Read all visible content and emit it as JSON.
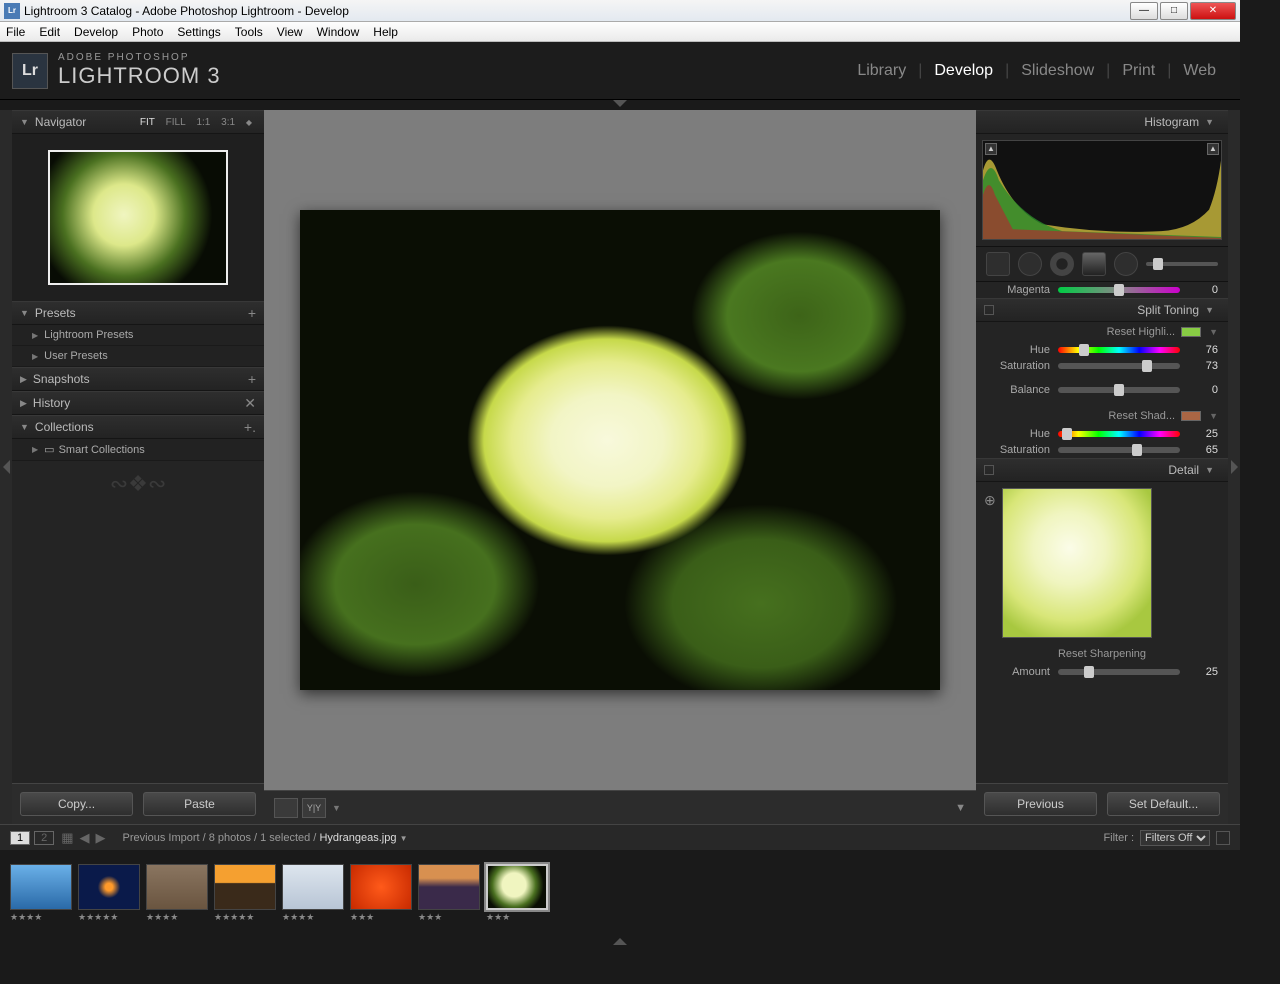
{
  "window": {
    "title": "Lightroom 3 Catalog - Adobe Photoshop Lightroom - Develop"
  },
  "menu": [
    "File",
    "Edit",
    "Develop",
    "Photo",
    "Settings",
    "Tools",
    "View",
    "Window",
    "Help"
  ],
  "brand": {
    "logo": "Lr",
    "sup": "ADOBE PHOTOSHOP",
    "main": "LIGHTROOM 3"
  },
  "modules": [
    "Library",
    "Develop",
    "Slideshow",
    "Print",
    "Web"
  ],
  "active_module": "Develop",
  "navigator": {
    "title": "Navigator",
    "zoom": [
      "FIT",
      "FILL",
      "1:1",
      "3:1"
    ],
    "zoom_active": "FIT"
  },
  "presets": {
    "title": "Presets",
    "items": [
      "Lightroom Presets",
      "User Presets"
    ]
  },
  "snapshots": {
    "title": "Snapshots"
  },
  "history": {
    "title": "History"
  },
  "collections": {
    "title": "Collections",
    "items": [
      "Smart Collections"
    ]
  },
  "copy": "Copy...",
  "paste": "Paste",
  "right": {
    "histogram": "Histogram",
    "magenta": {
      "label": "Magenta",
      "value": 0,
      "pos": 50
    },
    "split_toning": "Split Toning",
    "reset_high": "Reset Highli...",
    "hi_hue": {
      "label": "Hue",
      "value": 76,
      "pos": 21
    },
    "hi_sat": {
      "label": "Saturation",
      "value": 73,
      "pos": 73
    },
    "balance": {
      "label": "Balance",
      "value": 0,
      "pos": 50
    },
    "reset_shad": "Reset Shad...",
    "sh_hue": {
      "label": "Hue",
      "value": 25,
      "pos": 7
    },
    "sh_sat": {
      "label": "Saturation",
      "value": 65,
      "pos": 65
    },
    "detail": "Detail",
    "reset_sharp": "Reset Sharpening",
    "amount": {
      "label": "Amount",
      "value": 25,
      "pos": 25
    },
    "previous": "Previous",
    "set_default": "Set Default..."
  },
  "fs_header": {
    "pages": [
      "1",
      "2"
    ],
    "path": "Previous Import / 8 photos / 1 selected /",
    "file": "Hydrangeas.jpg",
    "filter_label": "Filter :",
    "filter_value": "Filters Off"
  },
  "thumbs": [
    {
      "bg": "linear-gradient(#6ab0e8,#2a6aa8),radial-gradient(circle at 40% 60%,#f7d43a 30%,transparent 32%)",
      "rating": "★★★★"
    },
    {
      "bg": "radial-gradient(circle at 50% 50%,#ff9a2a 10%,#0a1a4a 30%)",
      "rating": "★★★★★"
    },
    {
      "bg": "linear-gradient(#8a7560,#6a5540)",
      "rating": "★★★★"
    },
    {
      "bg": "linear-gradient(#f5a030 40%,#3a2a1a 42%)",
      "rating": "★★★★★"
    },
    {
      "bg": "linear-gradient(#dde5ee,#b8c5d5)",
      "rating": "★★★★"
    },
    {
      "bg": "radial-gradient(circle,#ff5a1a,#c82a00)",
      "rating": "★★★"
    },
    {
      "bg": "linear-gradient(#d89050 30%,#3a2a4a 50%)",
      "rating": "★★★"
    },
    {
      "bg": "radial-gradient(circle at 45% 45%,#f0f5c0 30%,#4a7020 55%,#0a0e04 75%)",
      "rating": "★★★",
      "sel": true
    }
  ]
}
